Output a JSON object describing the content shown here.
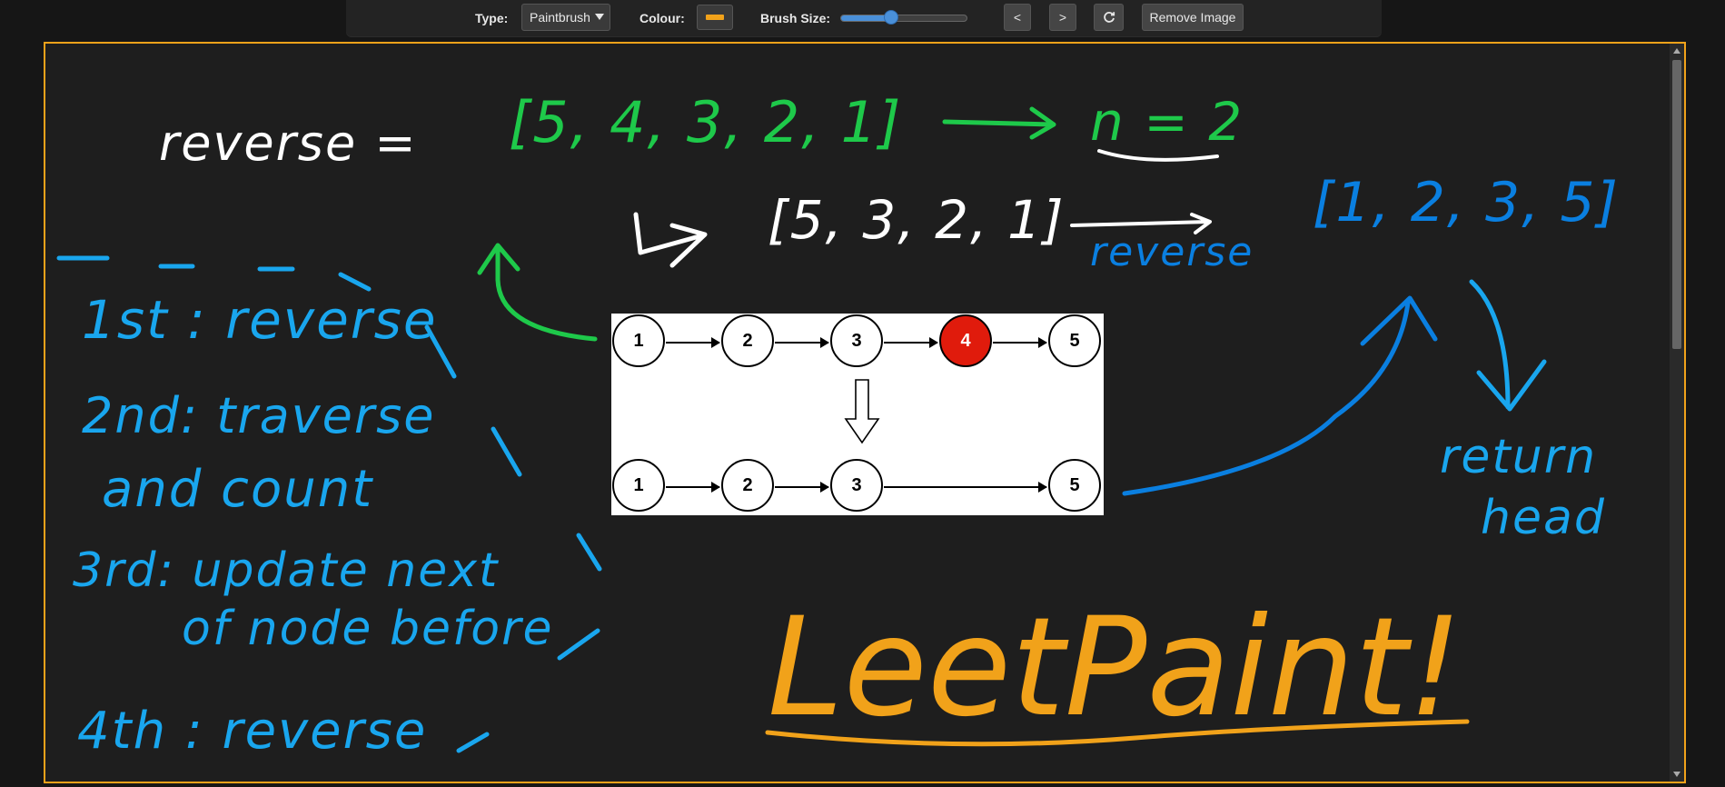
{
  "toolbar": {
    "type_label": "Type:",
    "type_value": "Paintbrush",
    "colour_label": "Colour:",
    "colour_value": "#f1a21a",
    "brush_label": "Brush Size:",
    "brush_fraction": 0.4,
    "prev_label": "<",
    "next_label": ">",
    "redo_icon": "refresh-icon",
    "remove_label": "Remove Image"
  },
  "image": {
    "top_row": [
      "1",
      "2",
      "3",
      "4",
      "5"
    ],
    "bottom_row": [
      "1",
      "2",
      "3",
      "5"
    ],
    "removed_color": "#e01b0c"
  },
  "drawing": {
    "colors": {
      "green": "#1ec94a",
      "white": "#ffffff",
      "blue": "#0a7fe0",
      "cyan": "#19a6ee",
      "orange": "#f1a21a"
    },
    "reverse_eq": "reverse =",
    "list_full": "[5, 4, 3, 2, 1]",
    "n_value": "n = 2",
    "list_removed": "[5, 3, 2, 1]",
    "reverse_label": "reverse",
    "list_result": "[1, 2, 3, 5]",
    "return_head": [
      "return",
      "head"
    ],
    "steps": [
      "1st : reverse",
      "2nd: traverse",
      "and count",
      "3rd: update next",
      "of node before",
      "4th : reverse"
    ],
    "title": "LeetPaint!"
  }
}
